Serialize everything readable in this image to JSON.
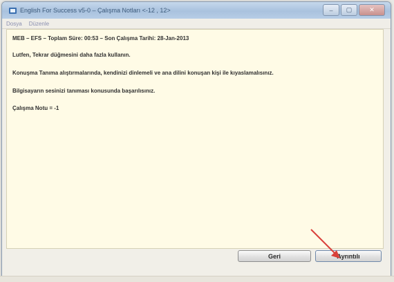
{
  "window": {
    "title": "English For Success v5-0  –  Çalışma Notları <-12 , 12>",
    "buttons": {
      "minimize": "–",
      "maximize": "▢",
      "close": "✕"
    }
  },
  "menu": {
    "items": [
      "Dosya",
      "Düzenle"
    ]
  },
  "content": {
    "lines": [
      "MEB  –  EFS  –  Toplam Süre: 00:53  –  Son Çalışma Tarihi: 28-Jan-2013",
      "Lutfen, Tekrar düğmesini daha fazla kullanın.",
      "Konuşma Tanıma alıştırmalarında, kendinizi dinlemeli ve ana dilini konuşan kişi ile kıyaslamalısınız.",
      "Bilgisayarın sesinizi tanıması konusunda başarılısınız.",
      "Çalışma Notu = -1"
    ]
  },
  "footer": {
    "back_label": "Geri",
    "details_label": "Ayrıntılı"
  },
  "colors": {
    "content_bg": "#fffbe6",
    "arrow": "#d9403a",
    "titlebar": "#a9c2de"
  },
  "icons": {
    "app": "app-icon"
  }
}
